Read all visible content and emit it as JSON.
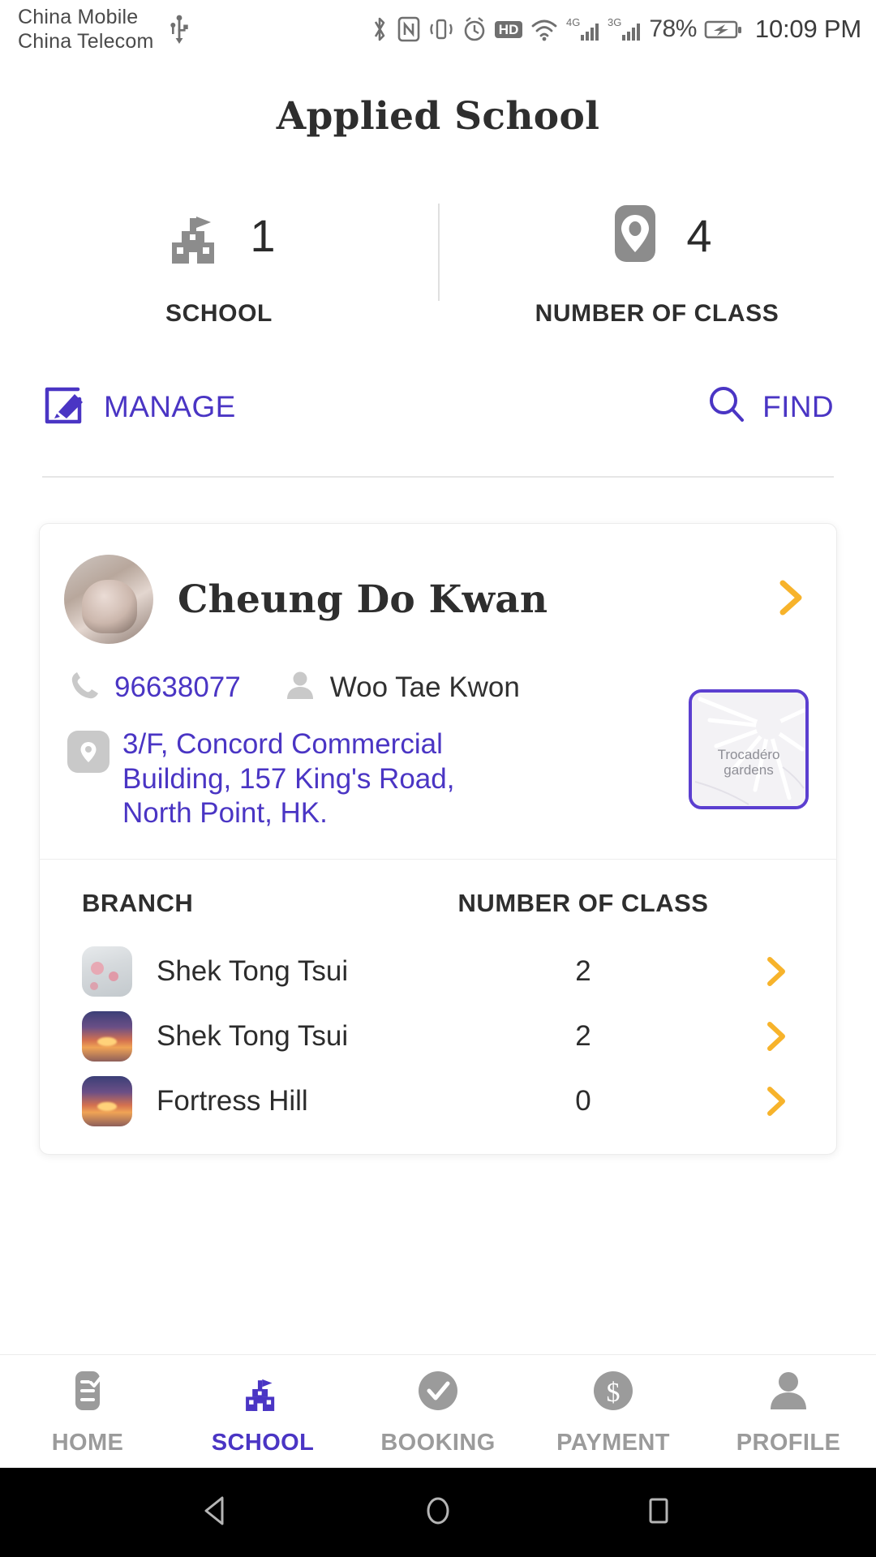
{
  "statusbar": {
    "carrier_line1": "China Mobile",
    "carrier_line2": "China Telecom",
    "usb_icon": "usb-icon",
    "bluetooth_icon": "bluetooth-icon",
    "nfc_icon": "nfc-icon",
    "vibrate_icon": "vibrate-icon",
    "alarm_icon": "alarm-icon",
    "hd_badge": "HD",
    "wifi_icon": "wifi-icon",
    "signal1_label": "4G",
    "signal2_label": "3G",
    "battery_percent": "78%",
    "battery_icon": "battery-charging-icon",
    "clock": "10:09 PM"
  },
  "header": {
    "title": "Applied School"
  },
  "stats": [
    {
      "icon": "school-building-icon",
      "value": "1",
      "label": "SCHOOL"
    },
    {
      "icon": "map-pin-icon",
      "value": "4",
      "label": "NUMBER OF CLASS"
    }
  ],
  "actions": {
    "manage": {
      "icon": "edit-pencil-icon",
      "label": "MANAGE"
    },
    "find": {
      "icon": "search-icon",
      "label": "FIND"
    }
  },
  "school_card": {
    "avatar": "school-avatar",
    "name": "Cheung Do Kwan",
    "chevron": "chevron-right-icon",
    "phone": {
      "icon": "phone-icon",
      "value": "96638077"
    },
    "contact": {
      "icon": "person-icon",
      "value": "Woo Tae Kwon"
    },
    "address": {
      "icon": "location-pin-icon",
      "value": "3/F, Concord Commercial Building, 157 King's Road, North Point, HK."
    },
    "map": {
      "icon": "map-thumbnail",
      "label": "Trocadéro gardens"
    },
    "table": {
      "columns": [
        "BRANCH",
        "NUMBER OF CLASS"
      ],
      "rows": [
        {
          "thumb": "blossom-thumbnail",
          "name": "Shek Tong Tsui",
          "count": "2",
          "chevron": "chevron-right-icon"
        },
        {
          "thumb": "sunset-thumbnail",
          "name": "Shek Tong Tsui",
          "count": "2",
          "chevron": "chevron-right-icon"
        },
        {
          "thumb": "sunset-thumbnail",
          "name": "Fortress Hill",
          "count": "0",
          "chevron": "chevron-right-icon"
        }
      ]
    }
  },
  "bottom_nav": [
    {
      "icon": "home-list-icon",
      "label": "HOME",
      "active": false
    },
    {
      "icon": "school-building-icon",
      "label": "SCHOOL",
      "active": true
    },
    {
      "icon": "check-circle-icon",
      "label": "BOOKING",
      "active": false
    },
    {
      "icon": "dollar-circle-icon",
      "label": "PAYMENT",
      "active": false
    },
    {
      "icon": "person-icon",
      "label": "PROFILE",
      "active": false
    }
  ],
  "android_nav": {
    "back": "back-triangle-icon",
    "home": "home-circle-icon",
    "recents": "recents-square-icon"
  },
  "colors": {
    "accent_purple": "#4a35c4",
    "chevron_orange": "#f7b32b",
    "icon_gray": "#8c8c8c",
    "text_dark": "#2e2e2e"
  }
}
